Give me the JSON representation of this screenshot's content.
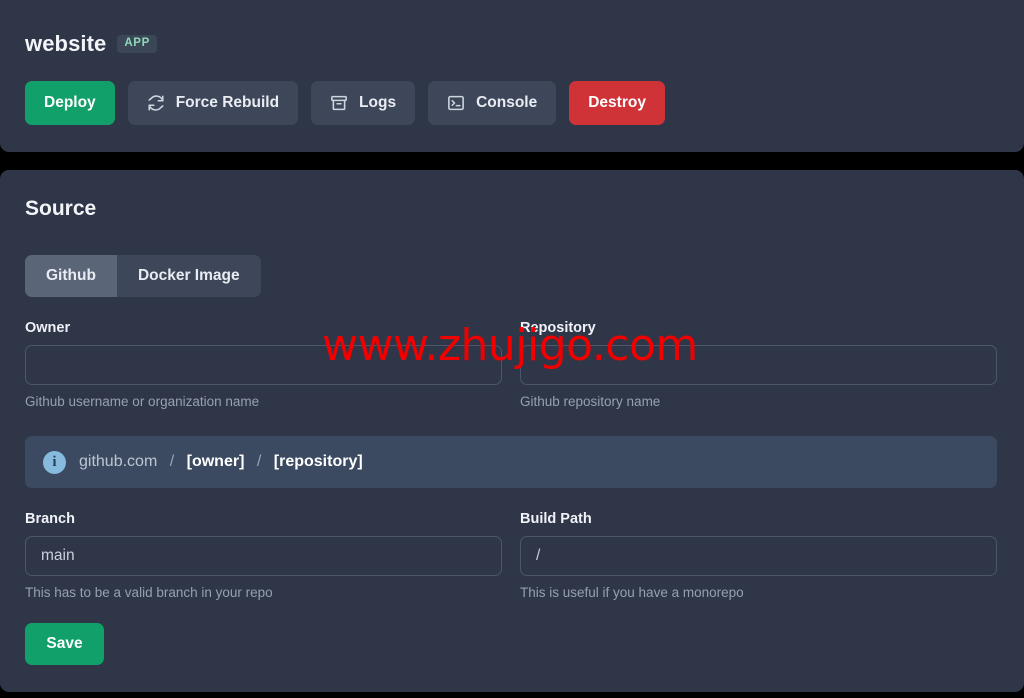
{
  "colors": {
    "page_background": "#000000",
    "panel": "#2e3648",
    "accent_green": "#12a06a",
    "danger_red": "#cf3338",
    "button_grey": "#3e4759",
    "tab_active": "#5b6578",
    "tab_inactive": "#3d4759",
    "info_banner": "#3b4a60",
    "info_icon": "#86bbdd",
    "badge_text": "#8fd9b8",
    "watermark": "#f20000"
  },
  "header": {
    "app_name": "website",
    "badge": "APP",
    "actions": [
      {
        "label": "Deploy",
        "icon": "",
        "style": "green"
      },
      {
        "label": "Force Rebuild",
        "icon": "refresh-icon",
        "style": "grey"
      },
      {
        "label": "Logs",
        "icon": "archive-icon",
        "style": "grey"
      },
      {
        "label": "Console",
        "icon": "terminal-icon",
        "style": "grey"
      },
      {
        "label": "Destroy",
        "icon": "",
        "style": "red"
      }
    ]
  },
  "source": {
    "title": "Source",
    "tabs": [
      {
        "label": "Github",
        "selected": true
      },
      {
        "label": "Docker Image",
        "selected": false
      }
    ],
    "fields": {
      "owner": {
        "label": "Owner",
        "value": "",
        "placeholder": "",
        "help": "Github username or organization name"
      },
      "repository": {
        "label": "Repository",
        "value": "",
        "placeholder": "",
        "help": "Github repository name"
      },
      "branch": {
        "label": "Branch",
        "value": "main",
        "placeholder": "main",
        "help": "This has to be a valid branch in your repo"
      },
      "build_path": {
        "label": "Build Path",
        "value": "/",
        "placeholder": "/",
        "help": "This is useful if you have a monorepo"
      }
    },
    "info_banner": {
      "icon": "info-icon",
      "host": "github.com",
      "separator": "/",
      "owner_placeholder": "[owner]",
      "repository_placeholder": "[repository]"
    },
    "save_label": "Save"
  },
  "watermark": {
    "text": "www.zhujigo.com"
  }
}
